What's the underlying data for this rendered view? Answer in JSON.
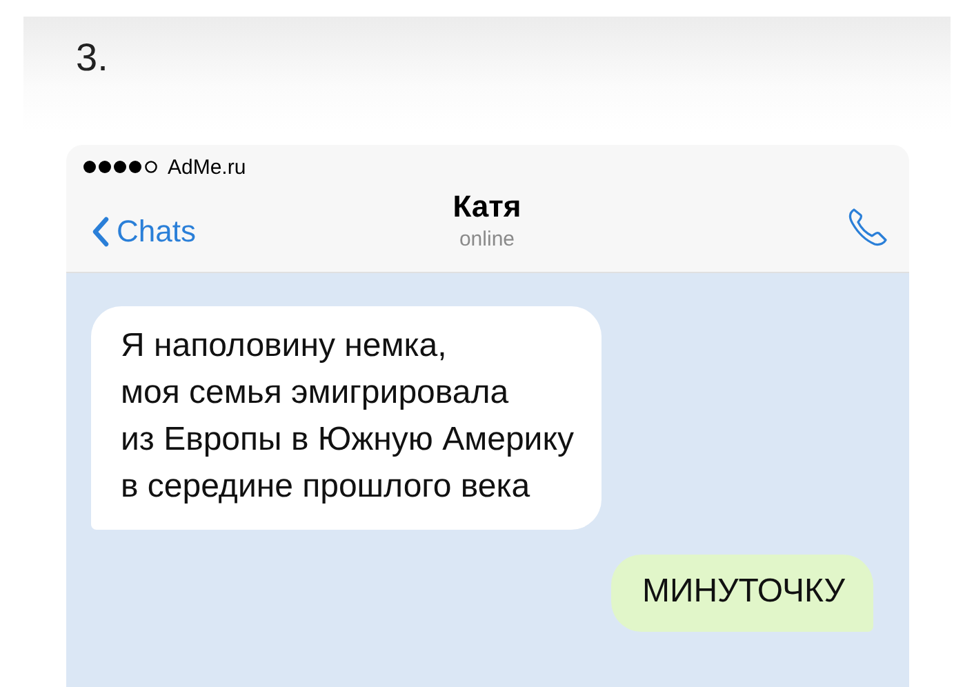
{
  "heading": "3.",
  "status_bar": {
    "carrier": "AdMe.ru"
  },
  "nav": {
    "back": "Chats",
    "title": "Катя",
    "subtitle": "online"
  },
  "messages": [
    {
      "kind": "incoming",
      "text": "Я наполовину немка,\nмоя семья эмигрировала\nиз Европы в Южную Америку\nв середине прошлого века"
    },
    {
      "kind": "outgoing",
      "text": "МИНУТОЧКУ"
    }
  ]
}
